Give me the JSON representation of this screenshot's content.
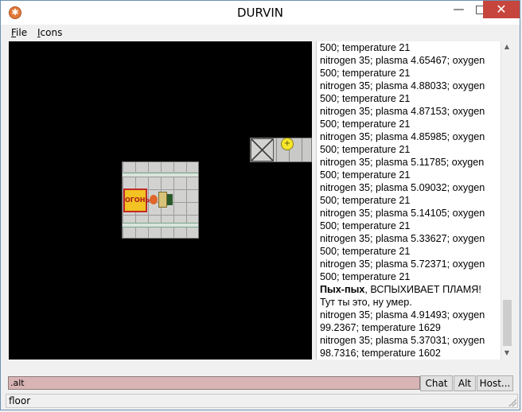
{
  "window": {
    "title": "DURVIN",
    "icon": "gear-icon",
    "controls": {
      "minimize": "—",
      "maximize": "□",
      "close": "✕"
    }
  },
  "menu": {
    "file": {
      "mnemonic": "F",
      "rest": "ile"
    },
    "icons": {
      "mnemonic": "I",
      "rest": "cons"
    }
  },
  "map": {
    "fire_sign": "ОГОНЬ"
  },
  "chat": {
    "lines": [
      {
        "text": "500; temperature 21"
      },
      {
        "text": "nitrogen 35; plasma 4.65467; oxygen"
      },
      {
        "text": "500; temperature 21"
      },
      {
        "text": "nitrogen 35; plasma 4.88033; oxygen"
      },
      {
        "text": "500; temperature 21"
      },
      {
        "text": "nitrogen 35; plasma 4.87153; oxygen"
      },
      {
        "text": "500; temperature 21"
      },
      {
        "text": "nitrogen 35; plasma 4.85985; oxygen"
      },
      {
        "text": "500; temperature 21"
      },
      {
        "text": "nitrogen 35; plasma 5.11785; oxygen"
      },
      {
        "text": "500; temperature 21"
      },
      {
        "text": "nitrogen 35; plasma 5.09032; oxygen"
      },
      {
        "text": "500; temperature 21"
      },
      {
        "text": "nitrogen 35; plasma 5.14105; oxygen"
      },
      {
        "text": "500; temperature 21"
      },
      {
        "text": "nitrogen 35; plasma 5.33627; oxygen"
      },
      {
        "text": "500; temperature 21"
      },
      {
        "text": "nitrogen 35; plasma 5.72371; oxygen"
      },
      {
        "text": "500; temperature 21"
      },
      {
        "bold": "Пых-пых",
        "text": ", ВСПЫХИВАЕТ ПЛАМЯ!"
      },
      {
        "text": "Тут ты это, ну умер."
      },
      {
        "text": "nitrogen 35; plasma 4.91493; oxygen"
      },
      {
        "text": "99.2367; temperature 1629"
      },
      {
        "text": "nitrogen 35; plasma 5.37031; oxygen"
      },
      {
        "text": "98.7316; temperature 1602"
      }
    ]
  },
  "input": {
    "value": ".alt"
  },
  "buttons": {
    "chat": "Chat",
    "alt": "Alt",
    "host": "Host..."
  },
  "status": {
    "text": "floor"
  }
}
